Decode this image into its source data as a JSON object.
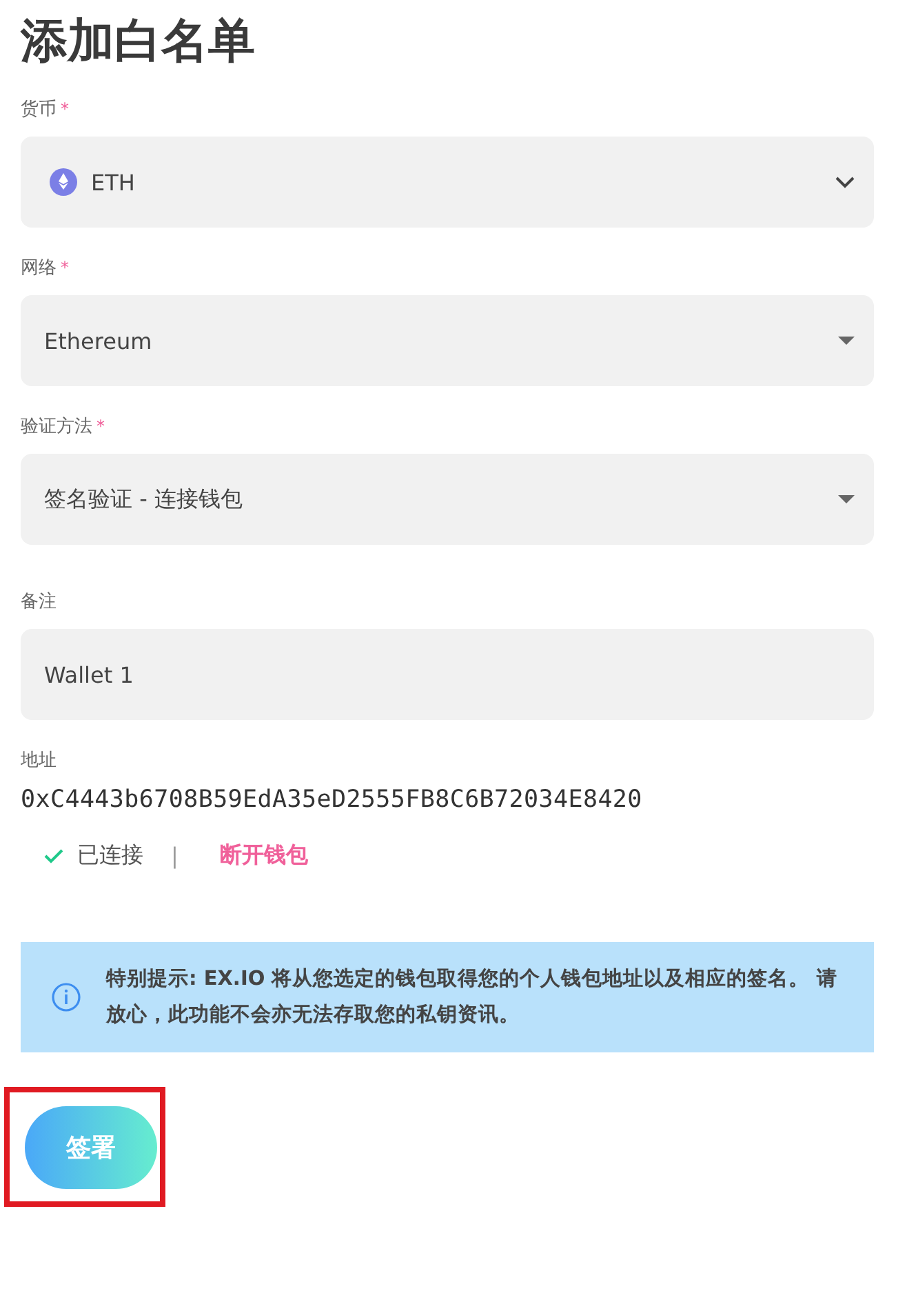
{
  "title": "添加白名单",
  "fields": [
    {
      "label": "货币",
      "required_mark": "*",
      "kind": "coin-select",
      "value": "ETH"
    },
    {
      "label": "网络",
      "required_mark": "*",
      "kind": "select",
      "value": "Ethereum"
    },
    {
      "label": "验证方法",
      "required_mark": "*",
      "kind": "select",
      "value": "签名验证 - 连接钱包"
    },
    {
      "label": "备注",
      "kind": "input",
      "value": "Wallet 1"
    }
  ],
  "address": {
    "label": "地址",
    "value": "0xC4443b6708B59EdA35eD2555FB8C6B72034E8420"
  },
  "connection": {
    "connected": true,
    "status": "已连接",
    "separator": "|",
    "disconnect": "断开钱包"
  },
  "notice": "特别提示: EX.IO 将从您选定的钱包取得您的个人钱包地址以及相应的签名。 请放心，此功能不会亦无法存取您的私钥资讯。",
  "submit": {
    "label": "签署",
    "highlighted": true
  }
}
